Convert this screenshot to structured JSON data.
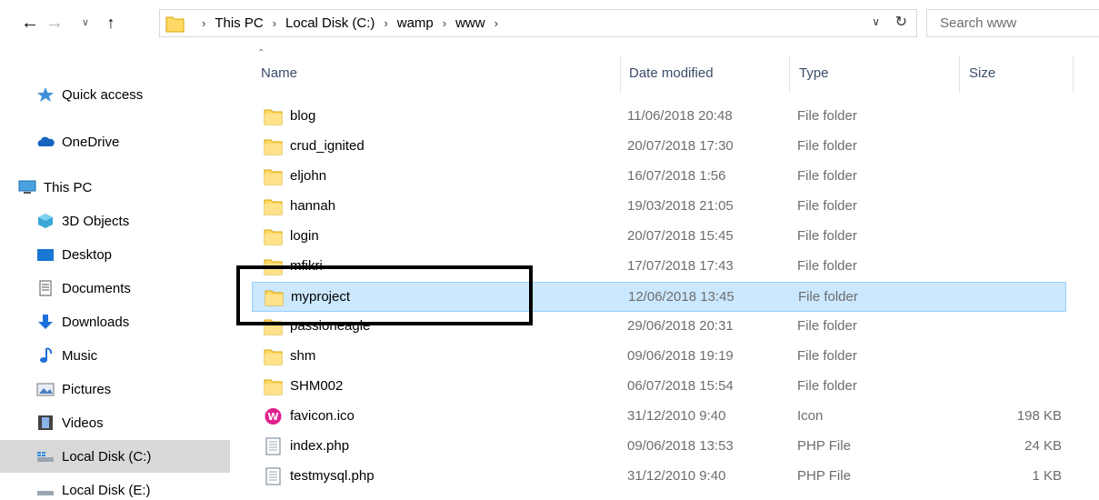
{
  "address_bar": {
    "crumbs": [
      "This PC",
      "Local Disk (C:)",
      "wamp",
      "www"
    ],
    "search_placeholder": "Search www"
  },
  "nav_pane": {
    "items": [
      {
        "label": "Quick access",
        "icon": "star-icon"
      },
      {
        "label": "OneDrive",
        "icon": "cloud-icon"
      },
      {
        "label": "This PC",
        "icon": "computer-icon"
      },
      {
        "label": "3D Objects",
        "icon": "cube-icon"
      },
      {
        "label": "Desktop",
        "icon": "desktop-icon"
      },
      {
        "label": "Documents",
        "icon": "document-icon"
      },
      {
        "label": "Downloads",
        "icon": "download-arrow-icon"
      },
      {
        "label": "Music",
        "icon": "music-note-icon"
      },
      {
        "label": "Pictures",
        "icon": "pictures-icon"
      },
      {
        "label": "Videos",
        "icon": "film-icon"
      },
      {
        "label": "Local Disk (C:)",
        "icon": "drive-icon"
      },
      {
        "label": "Local Disk (E:)",
        "icon": "drive-icon"
      }
    ],
    "selected": "Local Disk (C:)"
  },
  "file_list": {
    "columns": [
      "Name",
      "Date modified",
      "Type",
      "Size"
    ],
    "sorted_by": "Name",
    "files": [
      {
        "name": "blog",
        "date": "11/06/2018 20:48",
        "type": "File folder",
        "size": "",
        "icon": "folder-icon"
      },
      {
        "name": "crud_ignited",
        "date": "20/07/2018 17:30",
        "type": "File folder",
        "size": "",
        "icon": "folder-icon"
      },
      {
        "name": "eljohn",
        "date": "16/07/2018 1:56",
        "type": "File folder",
        "size": "",
        "icon": "folder-icon"
      },
      {
        "name": "hannah",
        "date": "19/03/2018 21:05",
        "type": "File folder",
        "size": "",
        "icon": "folder-icon"
      },
      {
        "name": "login",
        "date": "20/07/2018 15:45",
        "type": "File folder",
        "size": "",
        "icon": "folder-icon"
      },
      {
        "name": "mfikri",
        "date": "17/07/2018 17:43",
        "type": "File folder",
        "size": "",
        "icon": "folder-icon"
      },
      {
        "name": "myproject",
        "date": "12/06/2018 13:45",
        "type": "File folder",
        "size": "",
        "icon": "folder-icon"
      },
      {
        "name": "passioneagle",
        "date": "29/06/2018 20:31",
        "type": "File folder",
        "size": "",
        "icon": "folder-icon"
      },
      {
        "name": "shm",
        "date": "09/06/2018 19:19",
        "type": "File folder",
        "size": "",
        "icon": "folder-icon"
      },
      {
        "name": "SHM002",
        "date": "06/07/2018 15:54",
        "type": "File folder",
        "size": "",
        "icon": "folder-icon"
      },
      {
        "name": "favicon.ico",
        "date": "31/12/2010 9:40",
        "type": "Icon",
        "size": "198 KB",
        "icon": "wamp-icon"
      },
      {
        "name": "index.php",
        "date": "09/06/2018 13:53",
        "type": "PHP File",
        "size": "24 KB",
        "icon": "text-file-icon"
      },
      {
        "name": "testmysql.php",
        "date": "31/12/2010 9:40",
        "type": "PHP File",
        "size": "1 KB",
        "icon": "text-file-icon"
      }
    ],
    "selected": "myproject"
  },
  "colors": {
    "selected_row_bg": "#cce8ff",
    "selected_row_border": "#99d1ff",
    "nav_selected_bg": "#d9d9d9",
    "folder_yellow": "#ffd966",
    "annotation_border": "#000000"
  }
}
